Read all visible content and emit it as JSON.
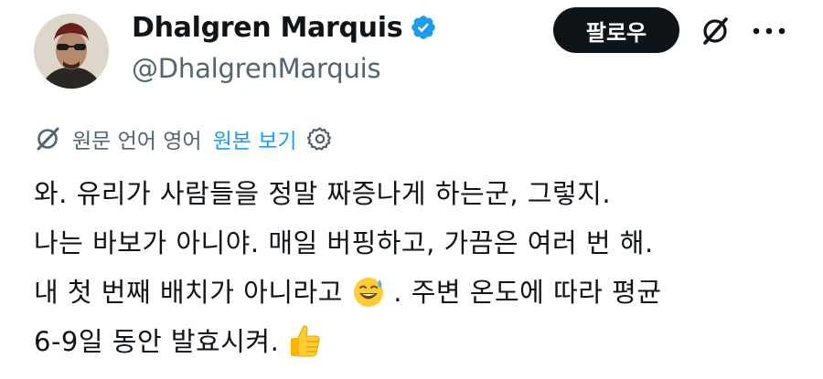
{
  "author": {
    "display_name": "Dhalgren Marquis",
    "handle": "@DhalgrenMarquis",
    "verified_color": "#1d9bf0"
  },
  "actions": {
    "follow_label": "팔로우",
    "grok_icon": "grok-icon",
    "more_icon": "more-icon"
  },
  "translation": {
    "info": "원문 언어 영어",
    "show_original": "원본 보기",
    "icon": "translate-icon",
    "settings_icon": "gear-icon"
  },
  "post": {
    "line1": "와. 유리가 사람들을 정말 짜증나게 하는군, 그렇지.",
    "line2": "나는 바보가 아니야. 매일 버핑하고, 가끔은 여러 번 해.",
    "line3a": "내 첫 번째 배치가 아니라고",
    "line3_emoji": "sweat-smile-emoji",
    "line3b": ". 주변 온도에 따라 평균",
    "line4": "6-9일 동안 발효시켜.",
    "line4_emoji": "thumbs-up-emoji"
  },
  "colors": {
    "text": "#0f1419",
    "secondary": "#536471",
    "link": "#1d9bf0",
    "button_bg": "#0f1419"
  }
}
